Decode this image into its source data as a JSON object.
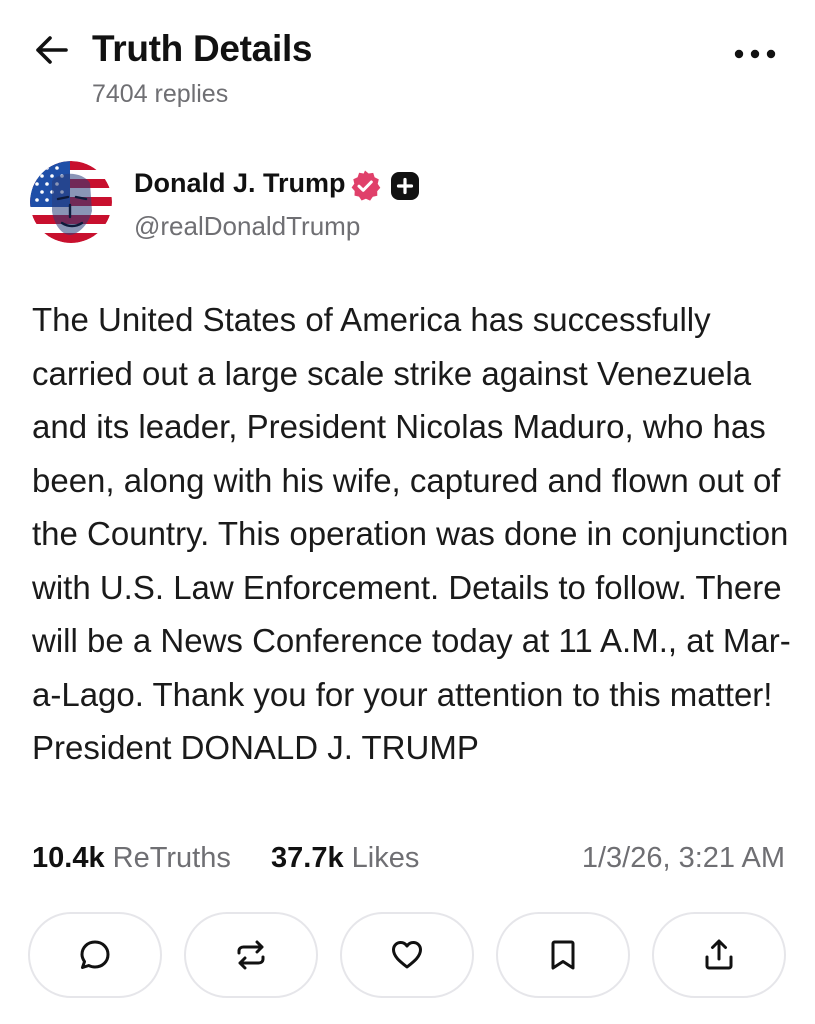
{
  "header": {
    "title": "Truth Details",
    "replies": "7404 replies"
  },
  "post": {
    "author_name": "Donald J. Trump",
    "handle": "@realDonaldTrump",
    "body": "The United States of America has successfully carried out a large scale strike against Venezuela and its leader, President Nicolas Maduro, who has been, along with his wife, captured and flown out of the Country. This operation was done in conjunction with U.S. Law Enforcement. Details to follow. There will be a News Conference today at 11 A.M., at Mar-a-Lago. Thank you for your attention to this matter! President DONALD J. TRUMP",
    "retruths_count": "10.4k",
    "retruths_label": "ReTruths",
    "likes_count": "37.7k",
    "likes_label": "Likes",
    "timestamp": "1/3/26, 3:21 AM"
  },
  "icons": {
    "back": "arrow-left-icon",
    "more": "more-horizontal-icon",
    "verified": "verified-badge-icon",
    "plus": "plus-badge-icon",
    "reply": "reply-bubble-icon",
    "retruth": "retruth-arrows-icon",
    "like": "heart-icon",
    "bookmark": "bookmark-icon",
    "share": "share-upload-icon"
  },
  "colors": {
    "verified": "#e0406a",
    "muted_text": "#6f6f73",
    "border": "#e6e6ea"
  }
}
